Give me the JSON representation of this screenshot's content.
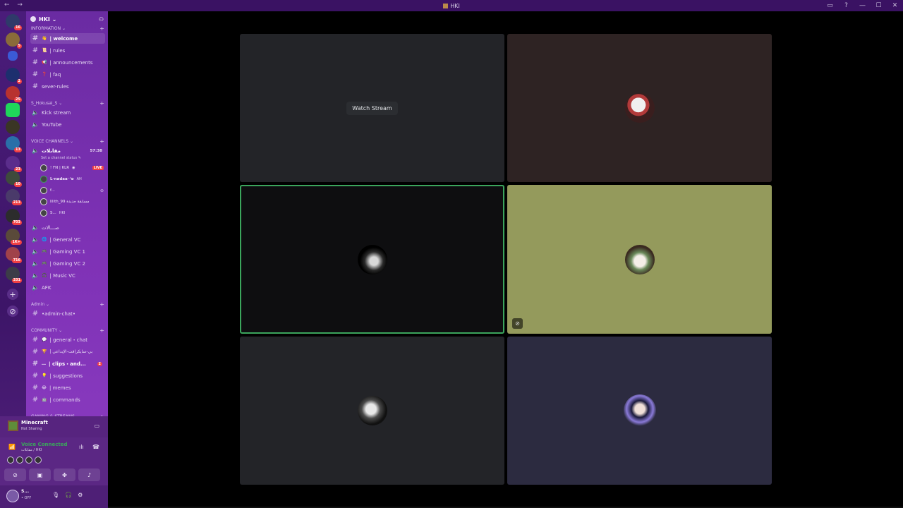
{
  "window": {
    "title": "HKI",
    "nav": "← →"
  },
  "servers": {
    "badges": [
      "16",
      "5",
      "2",
      "25",
      "13",
      "23",
      "10",
      "213",
      "703",
      "1K+",
      "716",
      "331"
    ]
  },
  "sidebar": {
    "server_name": "HKI ⌄",
    "categories": {
      "information": "INFORMATION ⌄",
      "s_hokusai": "S_Hokusai_S ⌄",
      "voice": "VOICE CHANNELS ⌄",
      "admin": "Admin ⌄",
      "community": "COMMUNITY ⌄",
      "gaming": "GAMING & STREAMS ⌄"
    },
    "channels": {
      "welcome": "| welcome",
      "rules": "| rules",
      "announcements": "| announcements",
      "faq": "| faq",
      "sever_rules": "sever-rules",
      "kick_stream": "Kick stream",
      "youtube": "YouTube",
      "maqablat": "مقابلات",
      "maqablat_timer": "57:38",
      "channel_status": "Set a channel status ✎",
      "sayalat": "صـــالات",
      "general_vc": "| General VC",
      "gaming_vc1": "| Gaming VC 1",
      "gaming_vc2": "| Gaming VC 2",
      "music_vc": "| Music VC",
      "afk": "AFK",
      "admin_chat": "•admin-chat•",
      "general_chat": "| general・chat",
      "creative": "| بي-سايكرافت-الإبداعي",
      "clips": "| clips・and...",
      "clips_badge": "2",
      "suggestions": "| suggestions",
      "memes": "| memes",
      "commands": "| commands"
    },
    "voice_users": [
      {
        "name": "! FN | KLR",
        "tag": "",
        "live": "LIVE"
      },
      {
        "name": "ᒪ-nadaa⁻ᶜᴅ",
        "tag": "AH",
        "live": ""
      },
      {
        "name": "f...",
        "tag": "",
        "live": ""
      },
      {
        "name": "lilith_99 مسابقة جديدة",
        "tag": "",
        "live": ""
      },
      {
        "name": "S...",
        "tag": "HKI",
        "live": ""
      }
    ]
  },
  "activity": {
    "game": "Minecraft",
    "status": "Not Sharing"
  },
  "voice_connection": {
    "title": "Voice Connected",
    "location": "مقابلات / HKI"
  },
  "user": {
    "name": "S...",
    "status": "• OFF"
  },
  "stage": {
    "watch_stream": "Watch Stream"
  },
  "colors": {
    "sidebar_gradient": "#6a2ba2",
    "speaking_outline": "#3ba55c",
    "live_badge": "#f23f43",
    "tile_olive": "#949a5c",
    "tile_navy": "#2c2b40",
    "tile_maroon": "#2e2323"
  }
}
